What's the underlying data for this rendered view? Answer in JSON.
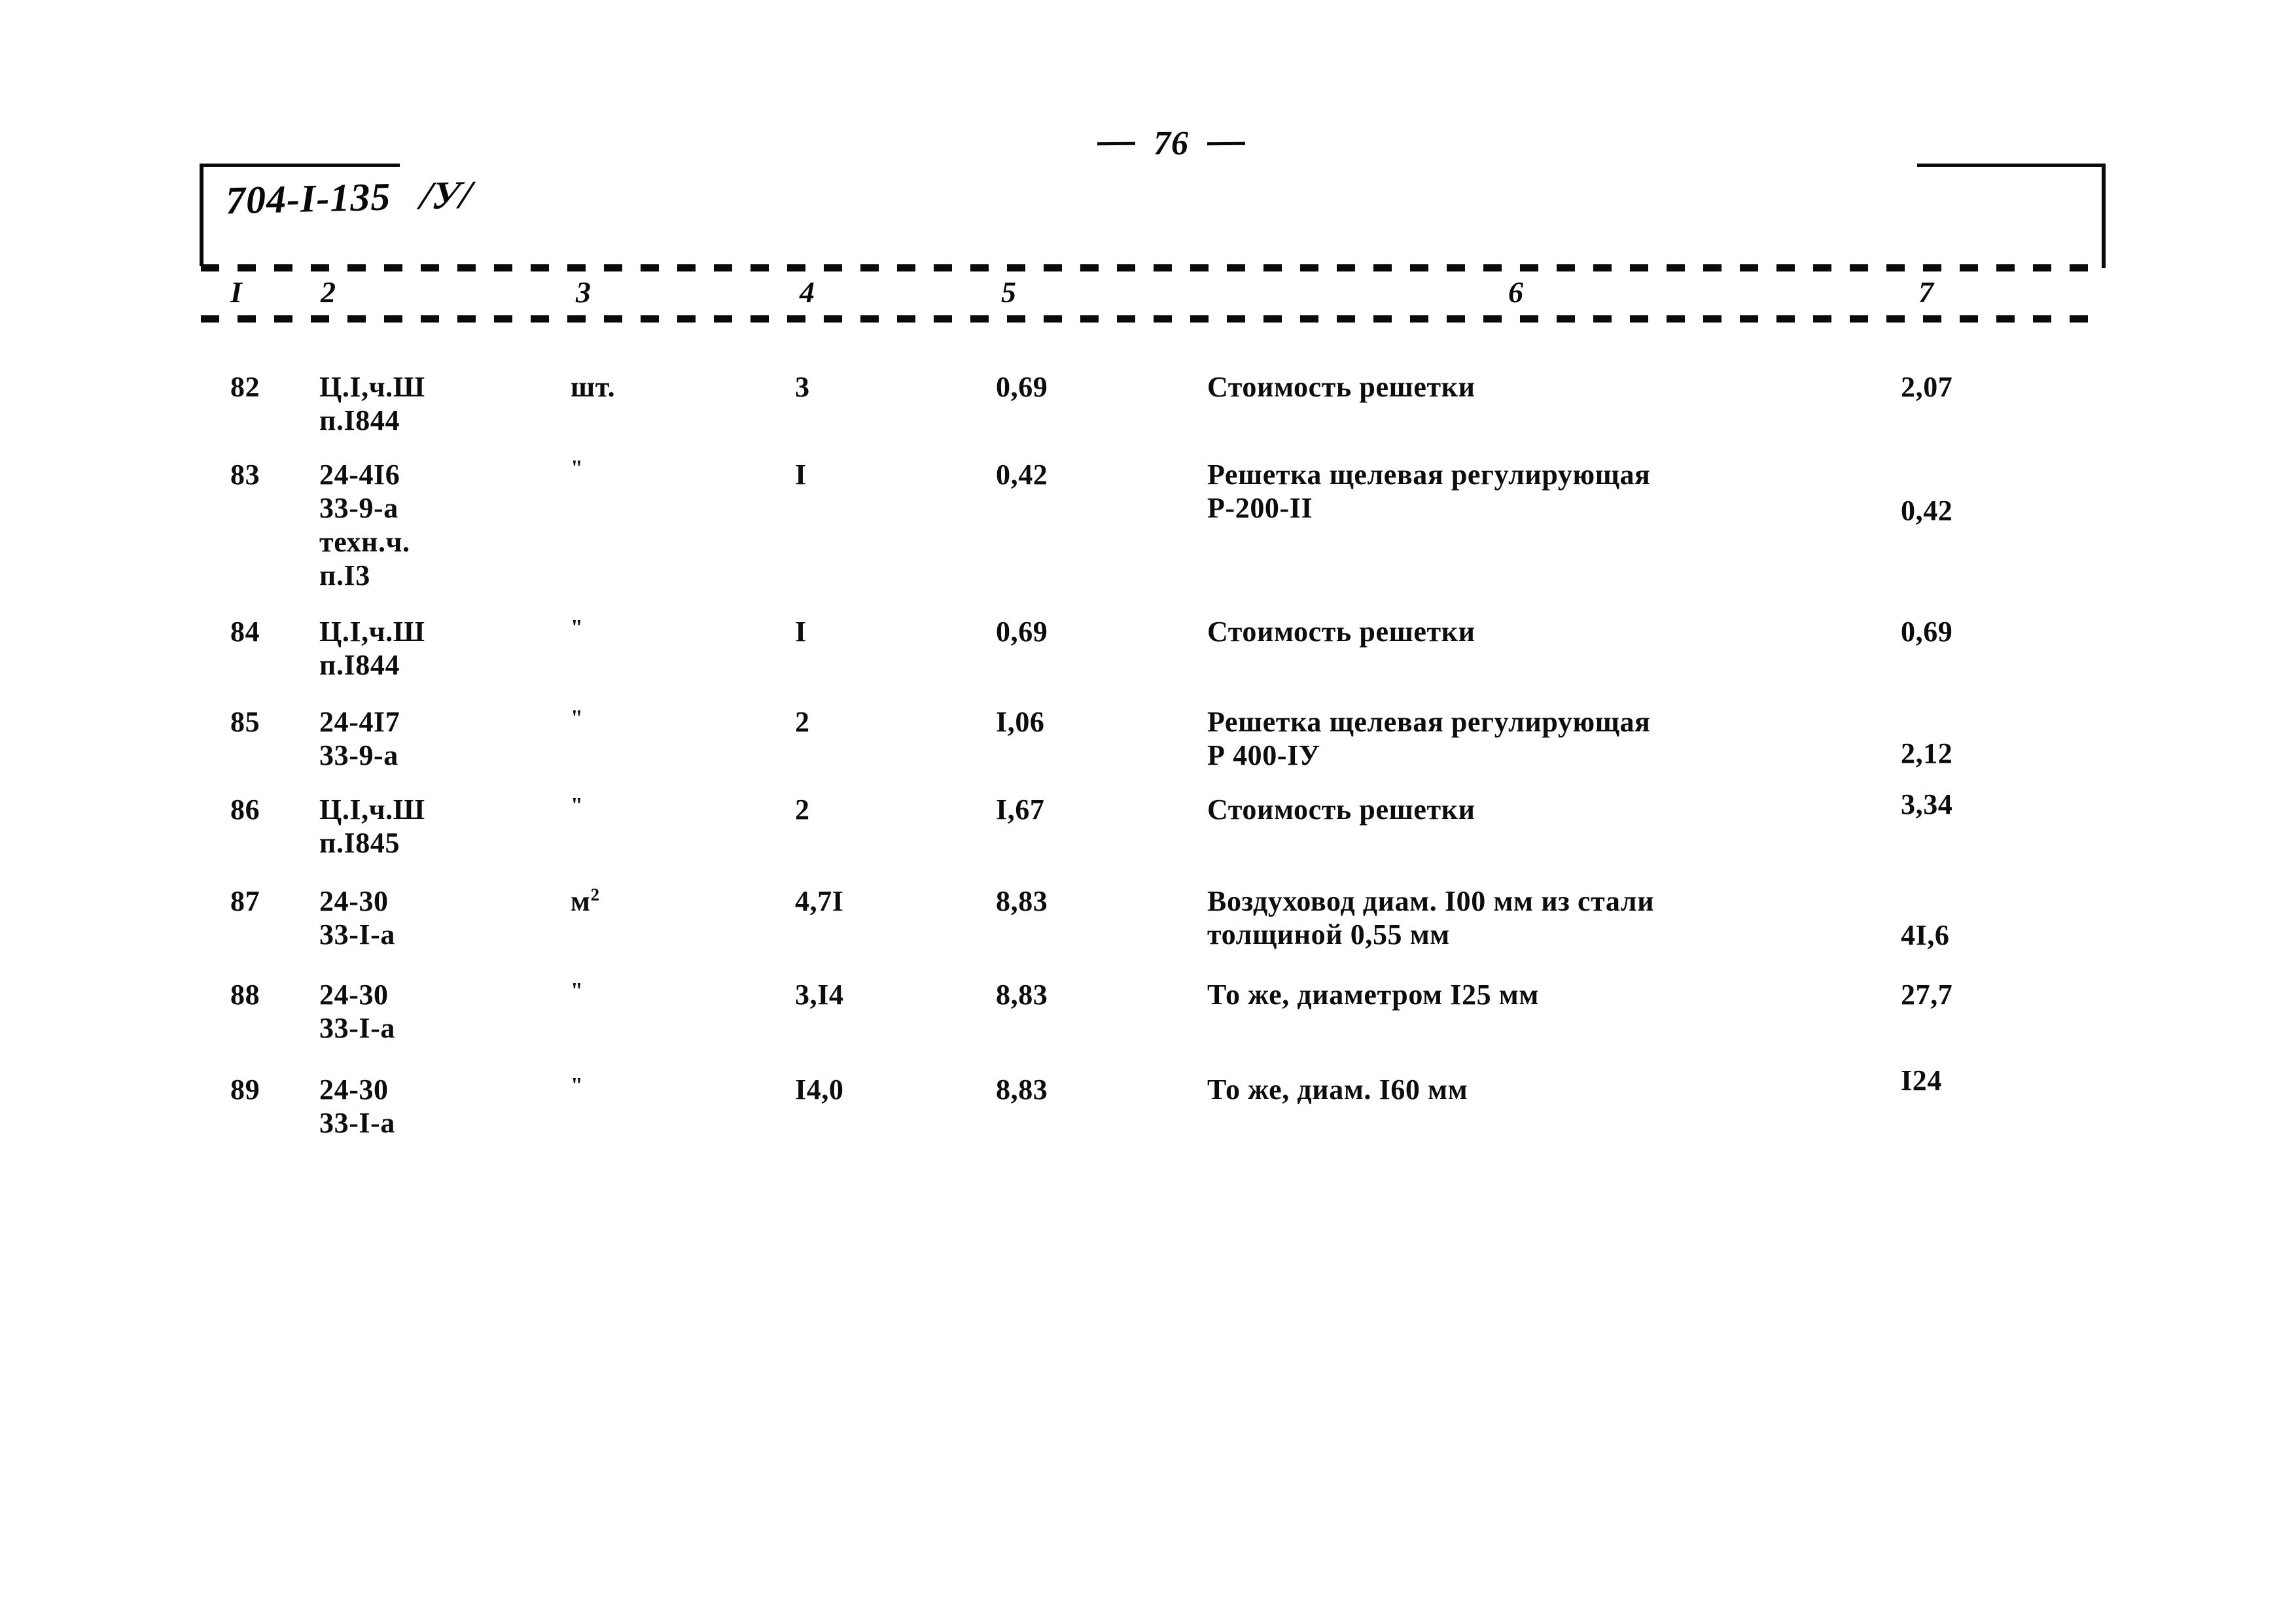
{
  "page": {
    "page_number": "76",
    "document_code": "704-I-135",
    "revision_mark": "/У/"
  },
  "table": {
    "column_headers": [
      "I",
      "2",
      "3",
      "4",
      "5",
      "6",
      "7"
    ],
    "rows": [
      {
        "num": "82",
        "code_lines": [
          "Ц.I,ч.Ш",
          "п.I844"
        ],
        "unit": "шт.",
        "quantity": "3",
        "price": "0,69",
        "description_lines": [
          "Стоимость решетки"
        ],
        "total": "2,07"
      },
      {
        "num": "83",
        "code_lines": [
          "24-4I6",
          "33-9-а",
          "техн.ч.",
          "п.I3"
        ],
        "unit": "\"",
        "quantity": "I",
        "price": "0,42",
        "description_lines": [
          "Решетка щелевая регулирующая",
          "Р-200-II"
        ],
        "total": "0,42"
      },
      {
        "num": "84",
        "code_lines": [
          "Ц.I,ч.Ш",
          "п.I844"
        ],
        "unit": "\"",
        "quantity": "I",
        "price": "0,69",
        "description_lines": [
          "Стоимость решетки"
        ],
        "total": "0,69"
      },
      {
        "num": "85",
        "code_lines": [
          "24-4I7",
          "33-9-а"
        ],
        "unit": "\"",
        "quantity": "2",
        "price": "I,06",
        "description_lines": [
          "Решетка щелевая регулирующая",
          "Р 400-IУ"
        ],
        "total": "2,12"
      },
      {
        "num": "86",
        "code_lines": [
          "Ц.I,ч.Ш",
          "п.I845"
        ],
        "unit": "\"",
        "quantity": "2",
        "price": "I,67",
        "description_lines": [
          "Стоимость решетки"
        ],
        "total": "3,34"
      },
      {
        "num": "87",
        "code_lines": [
          "24-30",
          "33-I-а"
        ],
        "unit": "м",
        "unit_superscript": "2",
        "quantity": "4,7I",
        "price": "8,83",
        "description_lines": [
          "Воздуховод диам. I00 мм из стали",
          "толщиной 0,55 мм"
        ],
        "total": "4I,6"
      },
      {
        "num": "88",
        "code_lines": [
          "24-30",
          "33-I-а"
        ],
        "unit": "\"",
        "quantity": "3,I4",
        "price": "8,83",
        "description_lines": [
          "То же, диаметром I25 мм"
        ],
        "total": "27,7"
      },
      {
        "num": "89",
        "code_lines": [
          "24-30",
          "33-I-а"
        ],
        "unit": "\"",
        "quantity": "I4,0",
        "price": "8,83",
        "description_lines": [
          "То же, диам. I60 мм"
        ],
        "total": "I24"
      }
    ]
  }
}
